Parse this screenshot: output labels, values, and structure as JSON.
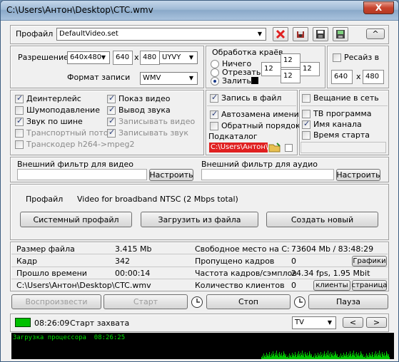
{
  "window": {
    "title": "C:\\Users\\Антон\\Desktop\\CTC.wmv",
    "close": "X"
  },
  "profile": {
    "label": "Профайл",
    "value": "DefaultVideo.set",
    "collapse": "^"
  },
  "resolution": {
    "label": "Разрешение",
    "size": "640x480",
    "width": "640",
    "x": "x",
    "height": "480",
    "format": "UYVY"
  },
  "record_format": {
    "label": "Формат записи",
    "value": "WMV"
  },
  "edges": {
    "title": "Обработка краёв",
    "opt_none": "Ничего",
    "opt_cut": "Отрезать",
    "opt_fill": "Залить",
    "v1": "12",
    "v2": "12",
    "v3": "12",
    "v4": "12"
  },
  "resize": {
    "label": "Ресайз в",
    "width": "640",
    "x": "x",
    "height": "480"
  },
  "options_left": [
    {
      "label": "Деинтерлейс",
      "checked": true,
      "disabled": false
    },
    {
      "label": "Шумоподавление",
      "checked": false,
      "disabled": false
    },
    {
      "label": "Звук по шине",
      "checked": true,
      "disabled": false
    },
    {
      "label": "Транспортный поток",
      "checked": false,
      "disabled": true
    },
    {
      "label": "Транскодер h264->mpeg2",
      "checked": false,
      "disabled": true
    }
  ],
  "options_mid": [
    {
      "label": "Показ видео",
      "checked": true,
      "disabled": false
    },
    {
      "label": "Вывод звука",
      "checked": true,
      "disabled": false
    },
    {
      "label": "Записывать видео",
      "checked": true,
      "disabled": true
    },
    {
      "label": "Записывать звук",
      "checked": true,
      "disabled": true
    }
  ],
  "record_to_file": "Запись в файл",
  "network_broadcast": "Вещание в сеть",
  "auto_name": "Автозамена имени",
  "reverse_order": "Обратный порядок",
  "subdir_label": "Подкаталог",
  "subdir_value": "C:\\Users\\Антон\\D",
  "tv_program": "ТВ программа",
  "channel_name": "Имя канала",
  "start_time": "Время старта",
  "video_filter": {
    "label": "Внешний фильтр для видео",
    "button": "Настроить"
  },
  "audio_filter": {
    "label": "Внешний фильтр для аудио",
    "button": "Настроить"
  },
  "profile_info": {
    "label": "Профайл",
    "value": "Video for broadband NTSC (2 Mbps total)"
  },
  "profile_buttons": {
    "system": "Системный профайл",
    "load": "Загрузить из файла",
    "create": "Создать новый"
  },
  "stats": {
    "file_size_label": "Размер файла",
    "file_size": "3.415 Mb",
    "free_space_label": "Свободное место на C:",
    "free_space": "73604 Mb / 83:48:29",
    "frame_label": "Кадр",
    "frame": "342",
    "skipped_label": "Пропущено кадров",
    "skipped": "0",
    "graphs_btn": "Графики",
    "elapsed_label": "Прошло времени",
    "elapsed": "00:00:14",
    "rate_label": "Частота кадров/сэмплов",
    "rate": "24.34 fps, 1.95 Mbit",
    "file_path": "C:\\Users\\Антон\\Desktop\\CTC.wmv",
    "clients_label": "Количество клиентов",
    "clients": "0",
    "clients_btn": "клиенты",
    "page_btn": "страница"
  },
  "controls": {
    "play": "Воспроизвести",
    "start": "Старт",
    "stop": "Стоп",
    "pause": "Пауза"
  },
  "status": {
    "time": "08:26:09",
    "text": "Старт захвата",
    "source": "TV",
    "prev": "<",
    "next": ">"
  },
  "cpu": {
    "label": "Загрузка процессора",
    "time": "08:26:25"
  },
  "colors": {
    "accent_red": "#e02020",
    "graph_green": "#00c000"
  }
}
